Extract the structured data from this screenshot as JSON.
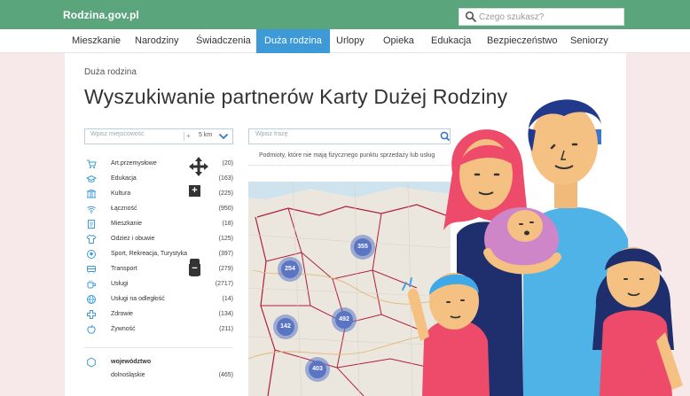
{
  "header": {
    "brand": "Rodzina.gov.pl",
    "search_placeholder": "Czego szukasz?"
  },
  "nav": {
    "items": [
      "Mieszkanie",
      "Narodziny",
      "Świadczenia",
      "Duża rodzina",
      "Urlopy",
      "Opieka",
      "Edukacja",
      "Bezpieczeństwo",
      "Seniorzy"
    ],
    "active": "Duża rodzina"
  },
  "page": {
    "breadcrumb": "Duża rodzina",
    "title": "Wyszukiwanie partnerów Karty Dużej Rodziny"
  },
  "filters": {
    "location_placeholder": "Wpisz miejscowość",
    "plus": "+",
    "distance": "5 km",
    "phrase_placeholder": "Wpisz frazę",
    "note": "Podmioty, które nie mają fizycznego punktu sprzedaży lub usług"
  },
  "categories": [
    {
      "label": "Art.przemysłowe",
      "count": "(20)",
      "icon": "cart-icon"
    },
    {
      "label": "Edukacja",
      "count": "(163)",
      "icon": "graduation-cap-icon"
    },
    {
      "label": "Kultura",
      "count": "(225)",
      "icon": "theater-icon"
    },
    {
      "label": "Łączność",
      "count": "(950)",
      "icon": "wifi-icon"
    },
    {
      "label": "Mieszkanie",
      "count": "(18)",
      "icon": "document-icon"
    },
    {
      "label": "Odzież i obuwie",
      "count": "(125)",
      "icon": "shirt-icon"
    },
    {
      "label": "Sport, Rekreacja, Turystyka",
      "count": "(397)",
      "icon": "ball-icon"
    },
    {
      "label": "Transport",
      "count": "(279)",
      "icon": "car-icon"
    },
    {
      "label": "Usługi",
      "count": "(2717)",
      "icon": "cup-icon"
    },
    {
      "label": "Usługi na odległość",
      "count": "(14)",
      "icon": "globe-icon"
    },
    {
      "label": "Zdrowie",
      "count": "(134)",
      "icon": "cross-icon"
    },
    {
      "label": "Żywność",
      "count": "(211)",
      "icon": "apple-icon"
    }
  ],
  "voivodeship": {
    "label": "województwo",
    "regions": [
      {
        "label": "dolnośląskie",
        "count": "(465)"
      }
    ]
  },
  "map": {
    "zoom_in": "+",
    "zoom_out": "−",
    "clusters": [
      "355",
      "254",
      "492",
      "142",
      "403"
    ]
  },
  "colors": {
    "header_green": "#5aa57c",
    "nav_active_blue": "#3d9ad6",
    "cluster_blue": "#5b74c4",
    "page_bg_pink": "#f7e9ea"
  }
}
